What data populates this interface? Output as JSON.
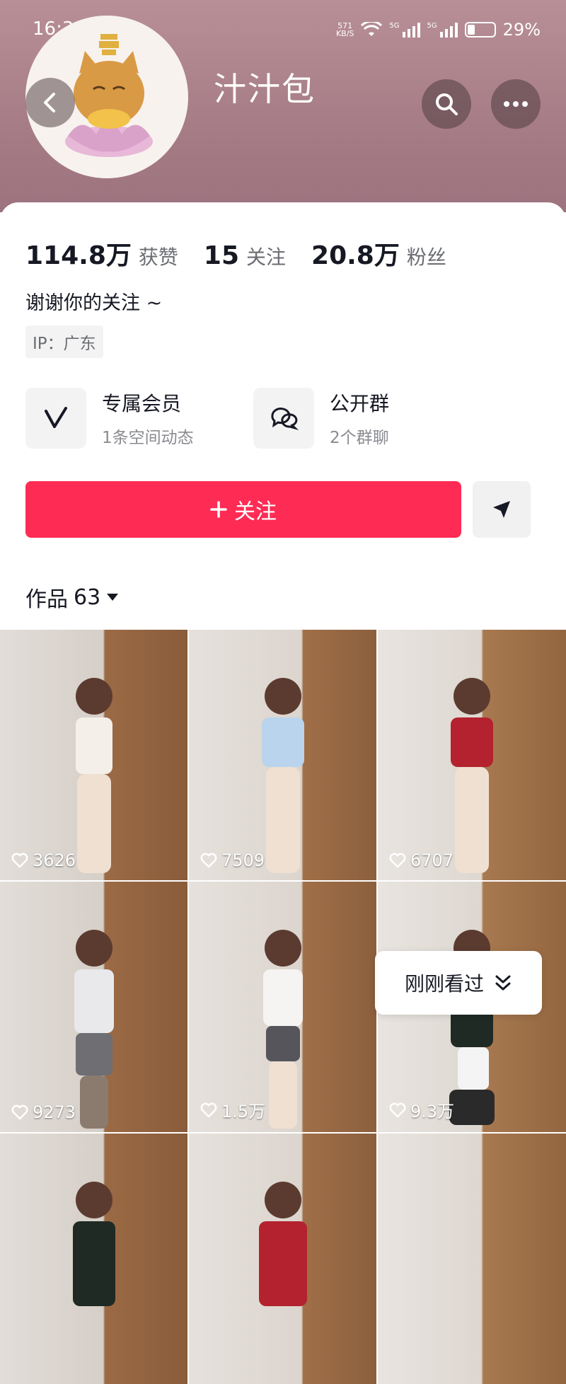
{
  "status": {
    "time": "16:31",
    "speed_value": "571",
    "speed_unit": "KB/S",
    "network1": "5G",
    "network2": "5G",
    "battery": "29%"
  },
  "profile": {
    "name": "汁汁包"
  },
  "stats": {
    "likes_value": "114.8万",
    "likes_label": "获赞",
    "following_value": "15",
    "following_label": "关注",
    "followers_value": "20.8万",
    "followers_label": "粉丝"
  },
  "bio": "谢谢你的关注 ~",
  "ip": "IP：广东",
  "features": [
    {
      "title": "专属会员",
      "subtitle": "1条空间动态",
      "icon": "vip-v-icon"
    },
    {
      "title": "公开群",
      "subtitle": "2个群聊",
      "icon": "group-chat-icon"
    }
  ],
  "actions": {
    "follow_label": "关注",
    "share_icon": "send-icon"
  },
  "works": {
    "label": "作品",
    "count": "63"
  },
  "grid": [
    {
      "likes": "3626"
    },
    {
      "likes": "7509"
    },
    {
      "likes": "6707"
    },
    {
      "likes": "9273"
    },
    {
      "likes": "1.5万"
    },
    {
      "likes": "9.3万"
    },
    {
      "likes": ""
    },
    {
      "likes": ""
    },
    {
      "likes": ""
    }
  ],
  "recent_label": "刚刚看过",
  "colors": {
    "accent": "#fe2c55",
    "header": "#a67c86"
  }
}
